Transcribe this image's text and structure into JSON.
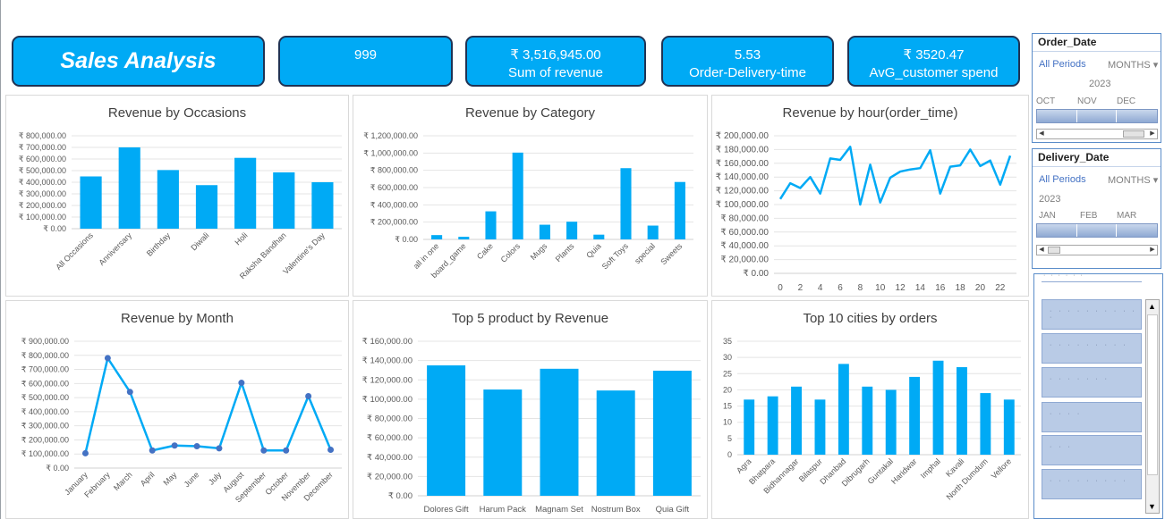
{
  "dashboard": {
    "title": "Sales Analysis",
    "kpis": [
      {
        "value": "999",
        "label": ""
      },
      {
        "value": "₹ 3,516,945.00",
        "label": "Sum of revenue"
      },
      {
        "value": "5.53",
        "label": "Order-Delivery-time"
      },
      {
        "value": "₹ 3520.47",
        "label": "AvG_customer spend"
      }
    ],
    "accent_color": "#00aaf5",
    "border_color": "#1f3354",
    "line_color": "#4472c4"
  },
  "slicers": {
    "order_date": {
      "title": "Order_Date",
      "filter": "All Periods",
      "level": "MONTHS",
      "year": "2023",
      "months": [
        "OCT",
        "NOV",
        "DEC"
      ]
    },
    "delivery_date": {
      "title": "Delivery_Date",
      "filter": "All Periods",
      "level": "MONTHS",
      "year": "2023",
      "months": [
        "JAN",
        "FEB",
        "MAR"
      ]
    },
    "list": {
      "header": "· · · · · ·",
      "items": [
        "· · · · · · · · · · ·",
        "· · · · · · · · ·",
        "· · · · · · ·",
        "· · · ·",
        "· · ·",
        "· · · · · · · · ·"
      ]
    }
  },
  "chart_data": [
    {
      "id": "occasions",
      "type": "bar",
      "title": "Revenue by Occasions",
      "categories": [
        "All Occasions",
        "Anniversary",
        "Birthday",
        "Diwali",
        "Holi",
        "Raksha Bandhan",
        "Valentine's Day"
      ],
      "values": [
        450000,
        700000,
        505000,
        375000,
        610000,
        485000,
        400000
      ],
      "yticks": [
        "₹ 0.00",
        "₹ 100,000.00",
        "₹ 200,000.00",
        "₹ 300,000.00",
        "₹ 400,000.00",
        "₹ 500,000.00",
        "₹ 600,000.00",
        "₹ 700,000.00",
        "₹ 800,000.00"
      ],
      "ylim": [
        0,
        800000
      ],
      "grid": true
    },
    {
      "id": "category",
      "type": "bar",
      "title": "Revenue by Category",
      "categories": [
        "all in one",
        "board_game",
        "Cake",
        "Colors",
        "Mugs",
        "Plants",
        "Quia",
        "Soft Toys",
        "special",
        "Sweets"
      ],
      "values": [
        50000,
        30000,
        325000,
        1005000,
        170000,
        205000,
        55000,
        825000,
        160000,
        665000
      ],
      "yticks": [
        "₹ 0.00",
        "₹ 200,000.00",
        "₹ 400,000.00",
        "₹ 600,000.00",
        "₹ 800,000.00",
        "₹ 1,000,000.00",
        "₹ 1,200,000.00"
      ],
      "ylim": [
        0,
        1200000
      ],
      "grid": true
    },
    {
      "id": "hour",
      "type": "line",
      "title": "Revenue by hour(order_time)",
      "x": [
        0,
        1,
        2,
        3,
        4,
        5,
        6,
        7,
        8,
        9,
        10,
        11,
        12,
        13,
        14,
        15,
        16,
        17,
        18,
        19,
        20,
        21,
        22,
        23
      ],
      "values": [
        108000,
        131000,
        124000,
        140000,
        116000,
        167000,
        165000,
        184000,
        100000,
        158000,
        103000,
        139000,
        148000,
        151000,
        153000,
        179000,
        116000,
        155000,
        157000,
        180000,
        156000,
        164000,
        129000,
        171000
      ],
      "xticks": [
        "0",
        "2",
        "4",
        "6",
        "8",
        "10",
        "12",
        "14",
        "16",
        "18",
        "20",
        "22"
      ],
      "yticks": [
        "₹ 0.00",
        "₹ 20,000.00",
        "₹ 40,000.00",
        "₹ 60,000.00",
        "₹ 80,000.00",
        "₹ 100,000.00",
        "₹ 120,000.00",
        "₹ 140,000.00",
        "₹ 160,000.00",
        "₹ 180,000.00",
        "₹ 200,000.00"
      ],
      "ylim": [
        0,
        200000
      ],
      "grid": true
    },
    {
      "id": "month",
      "type": "line",
      "title": "Revenue by Month",
      "categories": [
        "January",
        "February",
        "March",
        "April",
        "May",
        "June",
        "July",
        "August",
        "September",
        "October",
        "November",
        "December"
      ],
      "values": [
        105000,
        780000,
        540000,
        125000,
        160000,
        155000,
        140000,
        605000,
        125000,
        125000,
        510000,
        130000
      ],
      "yticks": [
        "₹ 0.00",
        "₹ 100,000.00",
        "₹ 200,000.00",
        "₹ 300,000.00",
        "₹ 400,000.00",
        "₹ 500,000.00",
        "₹ 600,000.00",
        "₹ 700,000.00",
        "₹ 800,000.00",
        "₹ 900,000.00"
      ],
      "ylim": [
        0,
        900000
      ],
      "grid": true,
      "markers": true
    },
    {
      "id": "top5",
      "type": "bar",
      "title": "Top 5 product by Revenue",
      "categories": [
        "Dolores Gift",
        "Harum Pack",
        "Magnam Set",
        "Nostrum Box",
        "Quia Gift"
      ],
      "values": [
        135000,
        110000,
        131500,
        109000,
        129500
      ],
      "yticks": [
        "₹ 0.00",
        "₹ 20,000.00",
        "₹ 40,000.00",
        "₹ 60,000.00",
        "₹ 80,000.00",
        "₹ 100,000.00",
        "₹ 120,000.00",
        "₹ 140,000.00",
        "₹ 160,000.00"
      ],
      "ylim": [
        0,
        160000
      ],
      "grid": true
    },
    {
      "id": "cities",
      "type": "bar",
      "title": "Top 10 cities by orders",
      "categories": [
        "Agra",
        "Bhatpara",
        "Bidhannagar",
        "Bilaspur",
        "Dhanbad",
        "Dibrugarh",
        "Guntakal",
        "Haridwar",
        "Imphal",
        "Kavali",
        "North Dumdum",
        "Vellore"
      ],
      "values": [
        17,
        18,
        21,
        17,
        28,
        21,
        20,
        24,
        29,
        27,
        19,
        17
      ],
      "yticks": [
        "0",
        "5",
        "10",
        "15",
        "20",
        "25",
        "30",
        "35"
      ],
      "ylim": [
        0,
        35
      ],
      "grid": true
    }
  ]
}
